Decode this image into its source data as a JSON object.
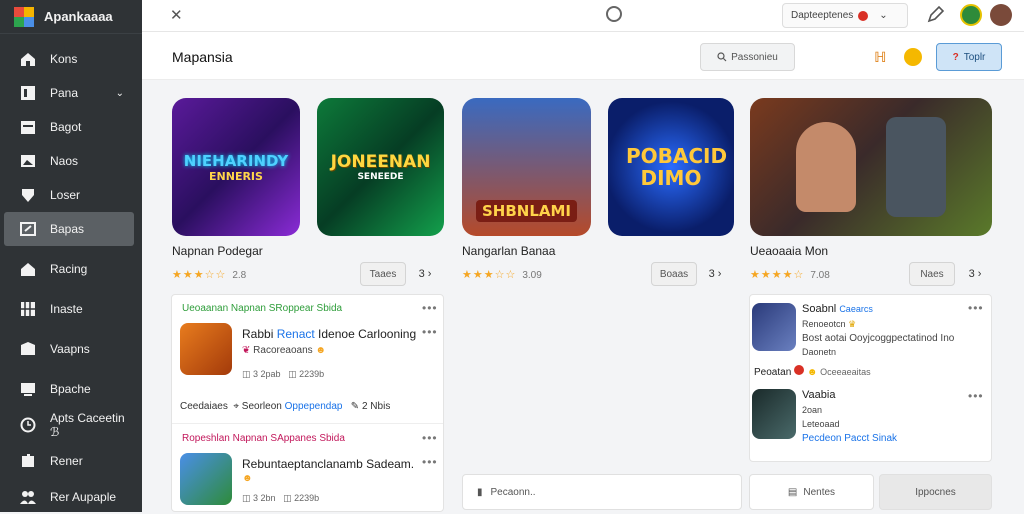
{
  "app": {
    "title": "Apankaaaa"
  },
  "sidebar": {
    "items": [
      {
        "label": "Kons",
        "icon": "home-icon"
      },
      {
        "label": "Pana",
        "icon": "bookmark-icon",
        "caret": "⌄"
      },
      {
        "label": "Bagot",
        "icon": "calendar-icon"
      },
      {
        "label": "Naos",
        "icon": "image-icon"
      },
      {
        "label": "Loser",
        "icon": "shield-icon"
      },
      {
        "label": "Bapas",
        "icon": "edit-icon",
        "active": true
      },
      {
        "label": "Racing",
        "icon": "house-icon"
      },
      {
        "label": "Inaste",
        "icon": "grid-icon"
      },
      {
        "label": "Vaapns",
        "icon": "tag-icon"
      },
      {
        "label": "Bpache",
        "icon": "monitor-icon"
      },
      {
        "label": "Apts Caceetin ℬ",
        "icon": "clock-icon"
      },
      {
        "label": "Rener",
        "icon": "puzzle-icon"
      },
      {
        "label": "Rer Aupaple",
        "icon": "users-icon"
      }
    ]
  },
  "topbar": {
    "close": "✕",
    "dropdown_label": "Dapteeptenes",
    "dropdown_caret": "⌄"
  },
  "header": {
    "title": "Mapansia",
    "search_label": "Passonieu",
    "button_label": "Toplr",
    "button_icon": "?",
    "icon1": "ℍ"
  },
  "games": [
    {
      "art": "NIEHARINDY",
      "art_sub": "ENNERIS",
      "name": "Napnan Podegar",
      "rating": "★★★☆☆",
      "rating_num": "2.8",
      "btn": "Taaes",
      "btn2": "3 ›"
    },
    {
      "art": "JONEENAN",
      "art_sub": "SENEEDE",
      "name": "",
      "rating": "",
      "rating_num": ""
    },
    {
      "art": "SHBNLAMI",
      "art_sub": "",
      "name": "Nangarlan Banaa",
      "rating": "★★★☆☆",
      "rating_num": "3.09",
      "btn": "Boaas",
      "btn2": "3 ›"
    },
    {
      "art": "POBACID DIMO",
      "art_sub": "",
      "name": "",
      "rating": "",
      "rating_num": ""
    },
    {
      "art": "",
      "art_sub": "",
      "name": "Ueaoaaia Mon",
      "rating": "★★★★☆",
      "rating_num": "7.08",
      "btn": "Naes",
      "btn2": "3 ›"
    }
  ],
  "feed_left": [
    {
      "head": "Ueoaanan Napnan SRoppear Sbida",
      "title_a": "Rabbi ",
      "title_b": "Renact",
      "title_c": " Idenoe Carlooning",
      "sub": "Racoreaoans",
      "meta1": "3 2pab",
      "meta2": "2239b",
      "footer_left": "Ceedaiaes",
      "footer_mid": "Seorleon ",
      "footer_link": "Oppependap",
      "footer_right": "2 Nbis"
    },
    {
      "head": "Ropeshlan Napnan SAppanes Sbida",
      "title": "Rebuntaeptanclanamb Sadeam.",
      "meta1": "3 2bn",
      "meta2": "2239b"
    }
  ],
  "feed_right": [
    {
      "name": "Soabnl ",
      "name_link": "Caearcs",
      "line1": "Renoeotcn",
      "line2": "Bost aotai Ooyjcoggpectatinod Ino",
      "line3": "Daonetn",
      "footer": "Peoatan",
      "footer2": "Oceeaeaitas"
    },
    {
      "name": "Vaabia",
      "line1": "2oan",
      "line2": "Leteoaad",
      "line3": "Pecdeon Pacct Sinak"
    }
  ],
  "bottom": {
    "left": "Pecaonn..",
    "mid": "Nentes",
    "right": "Ippocnes"
  }
}
